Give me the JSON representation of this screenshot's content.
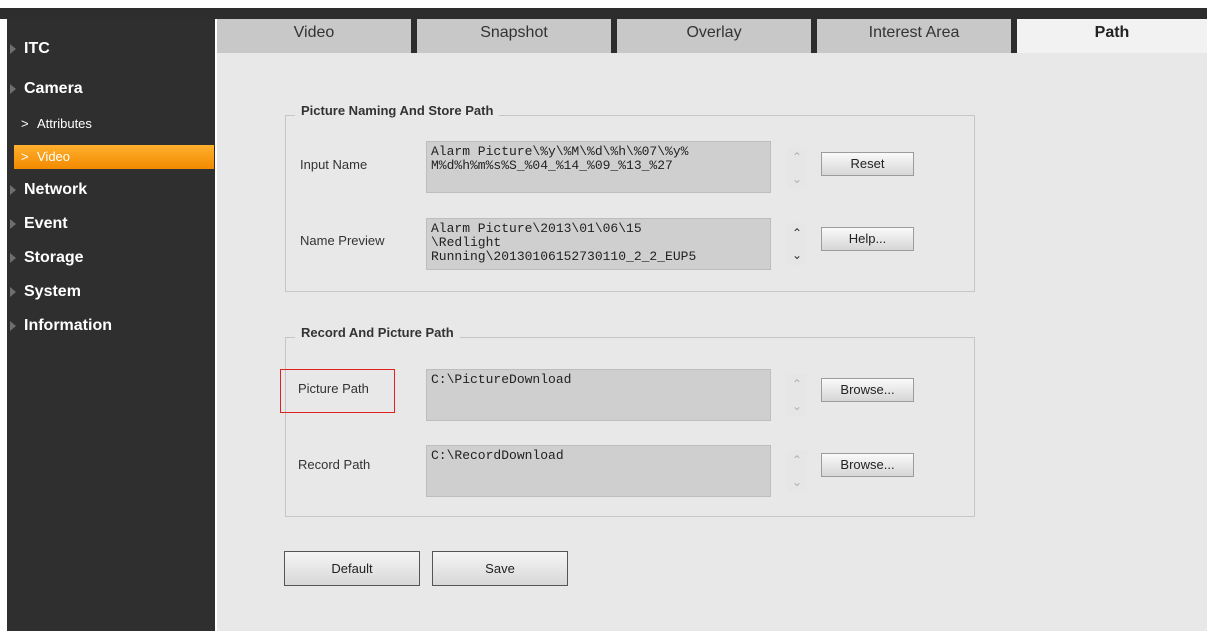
{
  "sidebar": {
    "itc": "ITC",
    "camera": "Camera",
    "attributes": "Attributes",
    "video": "Video",
    "network": "Network",
    "event": "Event",
    "storage": "Storage",
    "system": "System",
    "information": "Information",
    "sub_chevron": ">"
  },
  "tabs": {
    "video": "Video",
    "snapshot": "Snapshot",
    "overlay": "Overlay",
    "interest_area": "Interest Area",
    "path": "Path"
  },
  "naming_group": {
    "legend": "Picture Naming And Store Path",
    "input_name_label": "Input Name",
    "input_name_value": "Alarm Picture\\%y\\%M\\%d\\%h\\%07\\%y%\nM%d%h%m%s%S_%04_%14_%09_%13_%27",
    "name_preview_label": "Name Preview",
    "name_preview_value": "Alarm Picture\\2013\\01\\06\\15\n\\Redlight\nRunning\\20130106152730110_2_2_EUP5",
    "reset_button": "Reset",
    "help_button": "Help..."
  },
  "path_group": {
    "legend": "Record And Picture Path",
    "picture_path_label": "Picture Path",
    "picture_path_value": "C:\\PictureDownload",
    "record_path_label": "Record Path",
    "record_path_value": "C:\\RecordDownload",
    "browse_button": "Browse..."
  },
  "actions": {
    "default_button": "Default",
    "save_button": "Save"
  },
  "icons": {
    "scroll_up": "⌃",
    "scroll_down": "⌄"
  },
  "colors": {
    "accent": "#f28a00",
    "highlight_box": "#e0221e"
  }
}
